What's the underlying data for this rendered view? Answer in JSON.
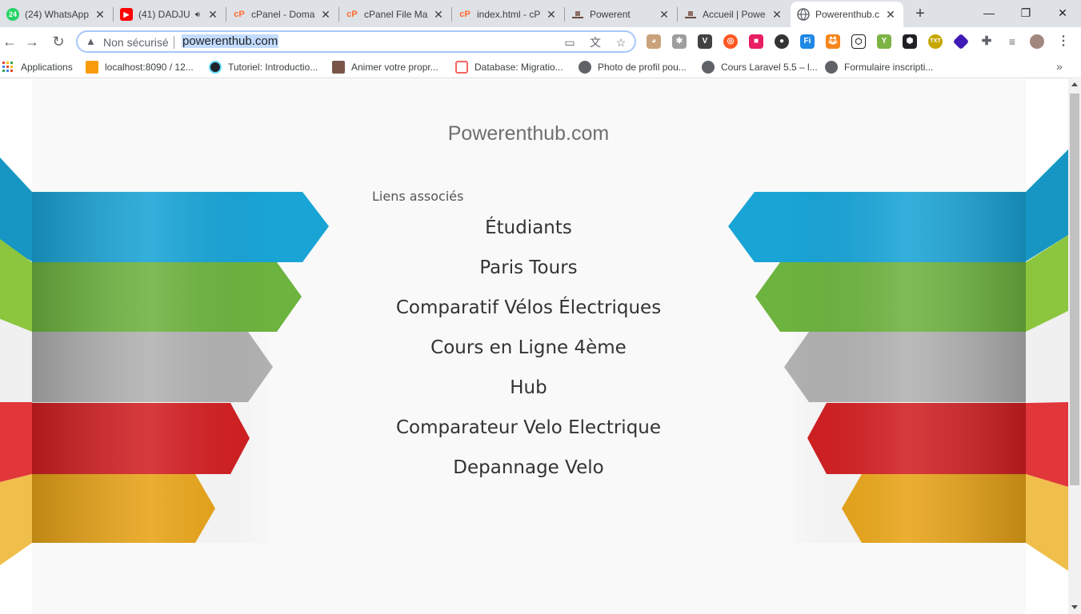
{
  "tabs": [
    {
      "title": "(24) WhatsApp",
      "icon": "whatsapp-icon",
      "badge": "24",
      "color": "#25d366"
    },
    {
      "title": "(41) DADJU",
      "icon": "youtube-icon",
      "color": "#ff0000",
      "audio": true
    },
    {
      "title": "cPanel - Doma",
      "icon": "cpanel-icon",
      "color": "#ff6c2c"
    },
    {
      "title": "cPanel File Ma",
      "icon": "cpanel-icon",
      "color": "#ff6c2c"
    },
    {
      "title": "index.html - cP",
      "icon": "cpanel-icon",
      "color": "#ff6c2c"
    },
    {
      "title": "Powerent",
      "icon": "hat-icon",
      "color": "#8d6e63"
    },
    {
      "title": "Accueil | Powe",
      "icon": "hat-icon",
      "color": "#8d6e63"
    },
    {
      "title": "Powerenthub.c",
      "icon": "globe-icon",
      "color": "#5f6368",
      "active": true
    }
  ],
  "toolbar": {
    "security_label": "Non sécurisé",
    "url": "powerenthub.com"
  },
  "bookmarks": [
    {
      "label": "Applications",
      "icon": "apps-grid-icon"
    },
    {
      "label": "localhost:8090 / 12...",
      "icon": "phpmyadmin-icon"
    },
    {
      "label": "Tutoriel: Introductio...",
      "icon": "react-icon"
    },
    {
      "label": "Animer votre propr...",
      "icon": "bookmark-image-icon"
    },
    {
      "label": "Database: Migratio...",
      "icon": "laravel-icon"
    },
    {
      "label": "Photo de profil pou...",
      "icon": "globe-icon"
    },
    {
      "label": "Cours Laravel 5.5 – l...",
      "icon": "globe-icon"
    },
    {
      "label": "Formulaire inscripti...",
      "icon": "globe-icon"
    }
  ],
  "page": {
    "site_title": "Powerenthub.com",
    "links_heading": "Liens associés",
    "links": [
      "Étudiants",
      "Paris Tours",
      "Comparatif Vélos Électriques",
      "Cours en Ligne 4ème",
      "Hub",
      "Comparateur Velo Electrique",
      "Depannage Velo"
    ]
  },
  "ribbons": {
    "colors": [
      "#19a4d6",
      "#6db33f",
      "#b1b1b1",
      "#d11f22",
      "#e7a316"
    ]
  }
}
